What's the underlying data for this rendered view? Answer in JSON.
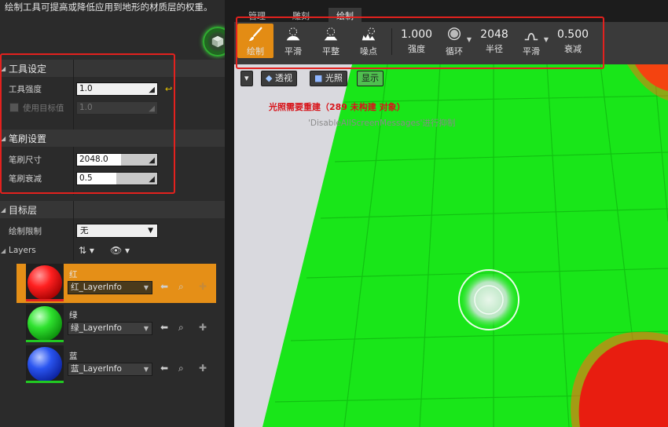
{
  "left": {
    "description": "绘制工具可提高或降低应用到地形的材质层的权重。",
    "tool_settings": {
      "title": "工具设定",
      "strength_label": "工具强度",
      "strength_value": "1.0",
      "use_target_label": "使用目标值",
      "use_target_value": "1.0"
    },
    "brush_settings": {
      "title": "笔刷设置",
      "size_label": "笔刷尺寸",
      "size_value": "2048.0",
      "falloff_label": "笔刷衰减",
      "falloff_value": "0.5"
    },
    "target_layers": {
      "title": "目标层",
      "paint_limit_label": "绘制限制",
      "paint_limit_value": "无",
      "layers_label": "Layers"
    },
    "layers": [
      {
        "name": "红",
        "info": "红_LayerInfo",
        "color": "#e22020"
      },
      {
        "name": "绿",
        "info": "绿_LayerInfo",
        "color": "#22c922"
      },
      {
        "name": "蓝",
        "info": "蓝_LayerInfo",
        "color": "#2048e0"
      }
    ]
  },
  "tabs": [
    "管理",
    "雕刻",
    "绘制"
  ],
  "toolbar": {
    "tools": [
      {
        "label": "绘制",
        "icon": "brush-icon"
      },
      {
        "label": "平滑",
        "icon": "smooth-icon"
      },
      {
        "label": "平整",
        "icon": "flatten-icon"
      },
      {
        "label": "噪点",
        "icon": "noise-icon"
      }
    ],
    "strength": {
      "value": "1.000",
      "label": "强度"
    },
    "shape": {
      "label": "循环",
      "icon": "circle-brush-icon"
    },
    "radius": {
      "value": "2048",
      "label": "半径"
    },
    "falloff_type": {
      "label": "平滑",
      "icon": "falloff-icon"
    },
    "falloff": {
      "value": "0.500",
      "label": "衰减"
    }
  },
  "viewport": {
    "perspective_label": "透视",
    "lighting_label": "光照",
    "show_label": "显示",
    "lighting_warning": "光照需要重建（289 未构建 对象）",
    "suppress_hint": "'DisableAllScreenMessages'进行抑制"
  },
  "colors": {
    "accent": "#e38c14",
    "highlight_box": "#e3211e",
    "terrain_green": "#19e619",
    "terrain_red": "#e81d10"
  }
}
